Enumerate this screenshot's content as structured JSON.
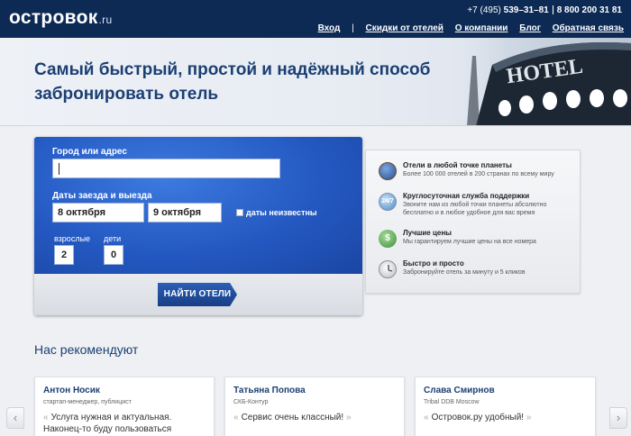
{
  "header": {
    "logo": "островок",
    "logo_tld": ".ru",
    "phone1_prefix": "+7 (495)",
    "phone1_number": "539–31–81",
    "phone2": "8 800 200 31 81",
    "nav": {
      "login": "Вход",
      "sep": "|",
      "discounts": "Скидки от отелей",
      "about": "О компании",
      "blog": "Блог",
      "feedback": "Обратная связь"
    }
  },
  "hero": {
    "title": "Самый быстрый, простой и надёжный способ забронировать отель",
    "sign": "HOTEL"
  },
  "search": {
    "city_label": "Город или адрес",
    "city_value": "",
    "dates_label": "Даты заезда и выезда",
    "checkin": "8 октября",
    "dash": "–",
    "checkout": "9 октября",
    "no_dates": "даты неизвестны",
    "adults_label": "взрослые",
    "adults": "2",
    "kids_label": "дети",
    "kids": "0",
    "find_button": "НАЙТИ ОТЕЛИ"
  },
  "features": [
    {
      "title": "Отели в любой точке планеты",
      "desc": "Более 100 000 отелей в 200 странах по всему миру",
      "icon": "globe-icon"
    },
    {
      "title": "Круглосуточная служба поддержки",
      "desc": "Звоните нам из любой точки планеты абсолютно бесплатно и в любое удобное для вас время",
      "icon": "support-24-icon",
      "badge": "24/7"
    },
    {
      "title": "Лучшие цены",
      "desc": "Мы гарантируем лучшие цены на все номера",
      "icon": "money-icon",
      "badge": "$"
    },
    {
      "title": "Быстро и просто",
      "desc": "Забронируйте отель за минуту и 5 кликов",
      "icon": "stopwatch-icon"
    }
  ],
  "recommend": {
    "title": "Нас рекомендуют",
    "cards": [
      {
        "name": "Антон Носик",
        "role": "стартап-менеджер, публицист",
        "quote": "Услуга нужная и актуальная. Наконец-то буду пользоваться сервисом в русском интернете."
      },
      {
        "name": "Татьяна Попова",
        "role": "СКБ-Контур",
        "quote": "Сервис очень классный!"
      },
      {
        "name": "Слава Смирнов",
        "role": "Tribal DDB Moscow",
        "quote": "Островок.ру удобный!"
      }
    ],
    "open_quote": "«",
    "close_quote": "»",
    "prev": "‹",
    "next": "›"
  }
}
